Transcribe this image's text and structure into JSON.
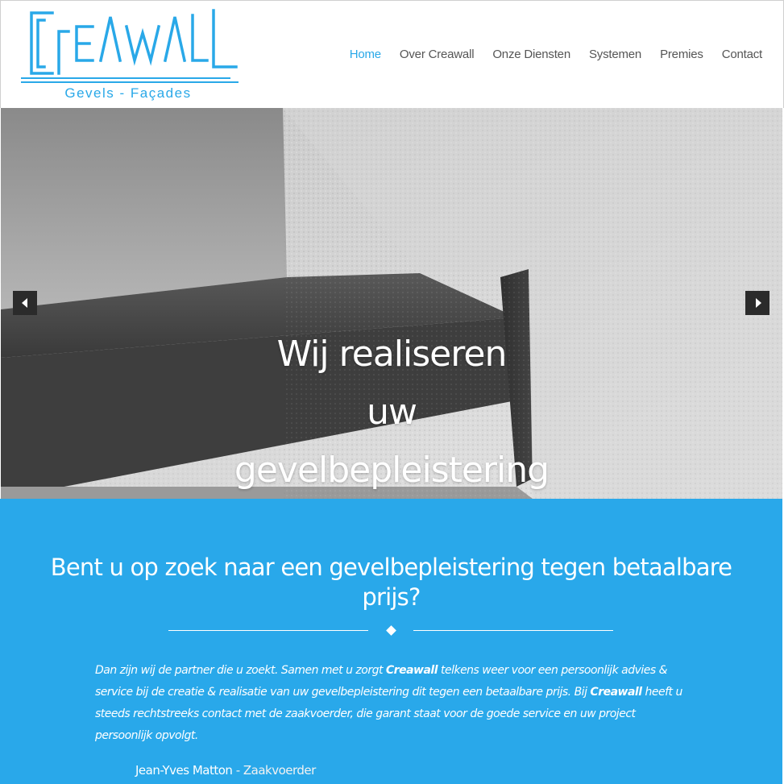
{
  "logo": {
    "wordmark": "CREAWALL",
    "tagline": "Gevels - Façades",
    "color": "#29a8e8"
  },
  "nav": {
    "items": [
      "Home",
      "Over Creawall",
      "Onze Diensten",
      "Systemen",
      "Premies",
      "Contact"
    ],
    "active": "Home"
  },
  "hero": {
    "line1": "Wij realiseren",
    "line2": "uw",
    "line3": "gevelbepleistering",
    "prev_icon": "arrow-left-icon",
    "next_icon": "arrow-right-icon"
  },
  "intro": {
    "heading": "Bent u op zoek naar een gevelbepleistering tegen betaalbare prijs?",
    "p_part1": "Dan zijn wij de partner die u zoekt. Samen met u zorgt ",
    "brand1": "Creawall",
    "p_part2": " telkens weer voor een persoonlijk advies & service bij de creatie & realisatie van uw gevelbepleistering dit tegen een betaalbare prijs. Bij ",
    "brand2": "Creawall",
    "p_part3": " heeft u steeds rechtstreeks contact met de zaakvoerder, die garant staat voor de goede service en uw project persoonlijk opvolgt.",
    "signature_name": "Jean-Yves Matton",
    "signature_role": " - Zaakvoerder",
    "background": "#29a8ea"
  }
}
